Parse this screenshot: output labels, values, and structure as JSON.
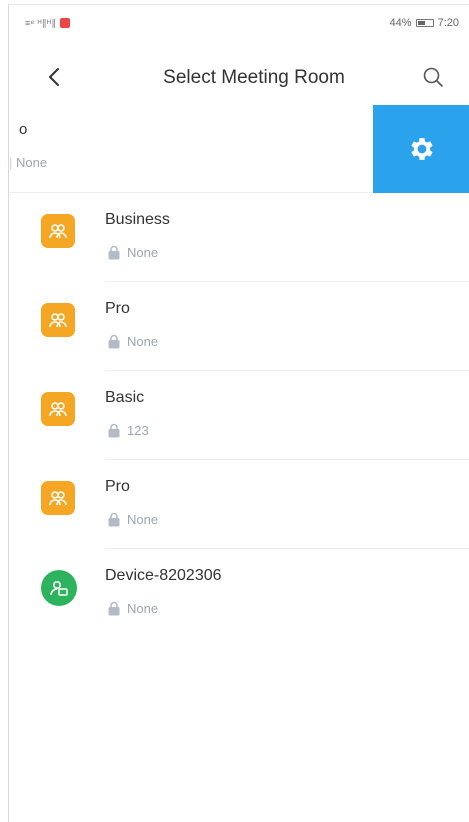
{
  "status_bar": {
    "signal_text": "≡ᵉ ᴴ∥ᴴ∥",
    "right_text": "44%",
    "time": "7:20"
  },
  "header": {
    "title": "Select Meeting Room"
  },
  "swiped_row": {
    "name": "o",
    "password": "None"
  },
  "rooms": [
    {
      "name": "Business",
      "password": "None",
      "type": "meeting-room"
    },
    {
      "name": "Pro",
      "password": "None",
      "type": "meeting-room"
    },
    {
      "name": "Basic",
      "password": "123",
      "type": "meeting-room"
    },
    {
      "name": "Pro",
      "password": "None",
      "type": "meeting-room"
    },
    {
      "name": "Device-8202306",
      "password": "None",
      "type": "device"
    }
  ],
  "colors": {
    "settings_action": "#2aa3ec",
    "room_avatar": "#f5a623",
    "device_avatar": "#2db35d",
    "secondary_text": "#9aa6b2"
  }
}
